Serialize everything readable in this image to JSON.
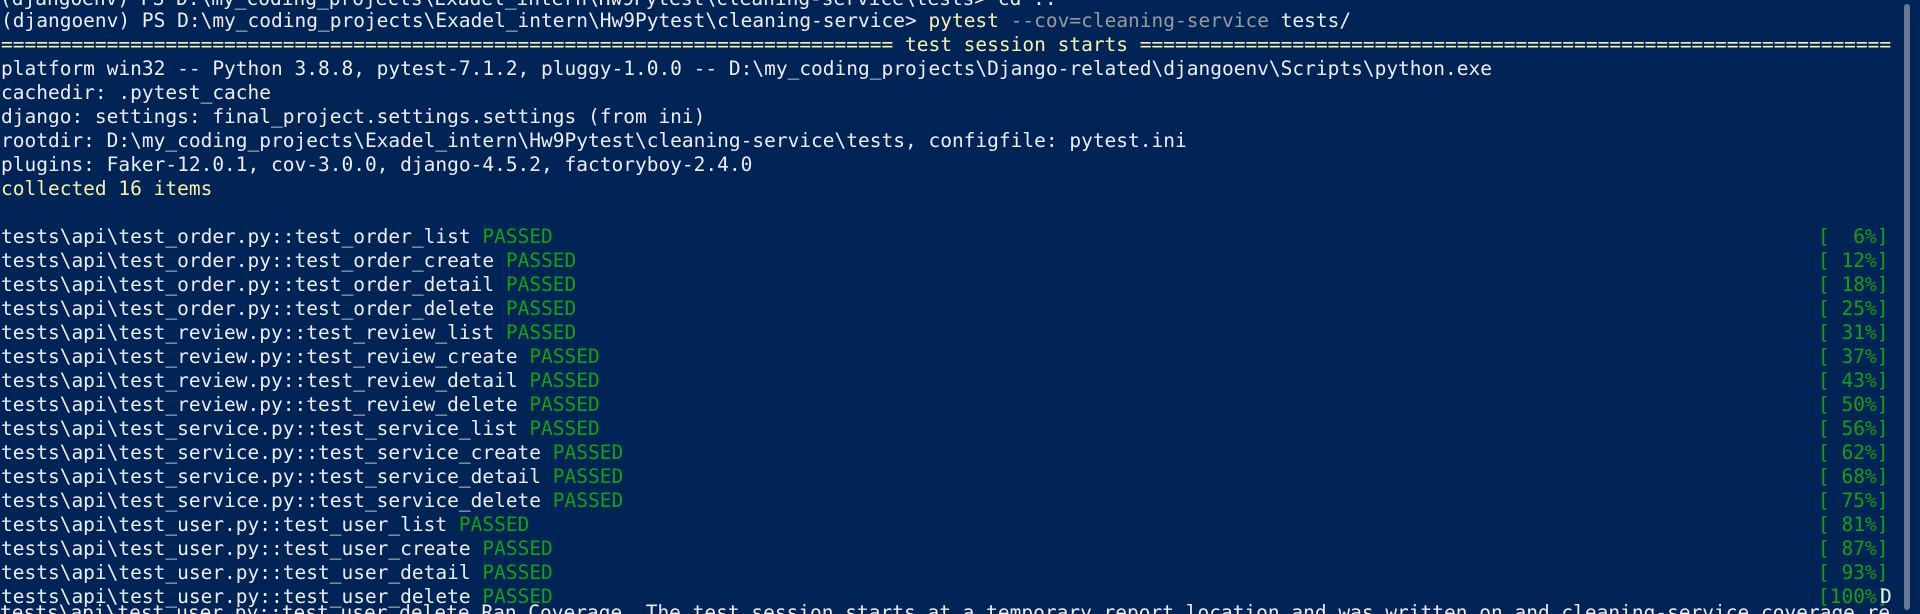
{
  "top_cut_line": "(djangoenv) PS D:\\my_coding_projects\\Exadel_intern\\Hw9Pytest\\cleaning-service\\tests> cd ..",
  "prompt": {
    "prefix": "(djangoenv) PS D:\\my_coding_projects\\Exadel_intern\\Hw9Pytest\\cleaning-service> ",
    "command": "pytest",
    "flag": " --cov=cleaning-service",
    "args": " tests/"
  },
  "session_header": "============================================================================ test session starts =============================================================================",
  "info_lines": [
    "platform win32 -- Python 3.8.8, pytest-7.1.2, pluggy-1.0.0 -- D:\\my_coding_projects\\Django-related\\djangoenv\\Scripts\\python.exe",
    "cachedir: .pytest_cache",
    "django: settings: final_project.settings.settings (from ini)",
    "rootdir: D:\\my_coding_projects\\Exadel_intern\\Hw9Pytest\\cleaning-service\\tests, configfile: pytest.ini",
    "plugins: Faker-12.0.1, cov-3.0.0, django-4.5.2, factoryboy-2.4.0"
  ],
  "collected": "collected 16 items",
  "tests": [
    {
      "name": "tests\\api\\test_order.py::test_order_list",
      "status": "PASSED",
      "pct": "[  6%]"
    },
    {
      "name": "tests\\api\\test_order.py::test_order_create",
      "status": "PASSED",
      "pct": "[ 12%]"
    },
    {
      "name": "tests\\api\\test_order.py::test_order_detail",
      "status": "PASSED",
      "pct": "[ 18%]"
    },
    {
      "name": "tests\\api\\test_order.py::test_order_delete",
      "status": "PASSED",
      "pct": "[ 25%]"
    },
    {
      "name": "tests\\api\\test_review.py::test_review_list",
      "status": "PASSED",
      "pct": "[ 31%]"
    },
    {
      "name": "tests\\api\\test_review.py::test_review_create",
      "status": "PASSED",
      "pct": "[ 37%]"
    },
    {
      "name": "tests\\api\\test_review.py::test_review_detail",
      "status": "PASSED",
      "pct": "[ 43%]"
    },
    {
      "name": "tests\\api\\test_review.py::test_review_delete",
      "status": "PASSED",
      "pct": "[ 50%]"
    },
    {
      "name": "tests\\api\\test_service.py::test_service_list",
      "status": "PASSED",
      "pct": "[ 56%]"
    },
    {
      "name": "tests\\api\\test_service.py::test_service_create",
      "status": "PASSED",
      "pct": "[ 62%]"
    },
    {
      "name": "tests\\api\\test_service.py::test_service_detail",
      "status": "PASSED",
      "pct": "[ 68%]"
    },
    {
      "name": "tests\\api\\test_service.py::test_service_delete",
      "status": "PASSED",
      "pct": "[ 75%]"
    },
    {
      "name": "tests\\api\\test_user.py::test_user_list",
      "status": "PASSED",
      "pct": "[ 81%]"
    },
    {
      "name": "tests\\api\\test_user.py::test_user_create",
      "status": "PASSED",
      "pct": "[ 87%]"
    },
    {
      "name": "tests\\api\\test_user.py::test_user_detail",
      "status": "PASSED",
      "pct": "[ 93%]"
    },
    {
      "name": "tests\\api\\test_user.py::test_user_delete",
      "status": "PASSED",
      "pct": "[100%]",
      "trailing": "D"
    }
  ],
  "bottom_cut_line": "tests\\api\\test_user.py::test_user_delete Ran Coverage. The test session starts at a temporary report location and was written on and cleaning-service coverage report",
  "colors": {
    "background": "#012456",
    "text": "#eeedf0",
    "yellow": "#f9f1a5",
    "gray": "#9a9a9a",
    "green": "#13a10e"
  },
  "icons": {
    "scrollbar": "scrollbar-thumb"
  }
}
